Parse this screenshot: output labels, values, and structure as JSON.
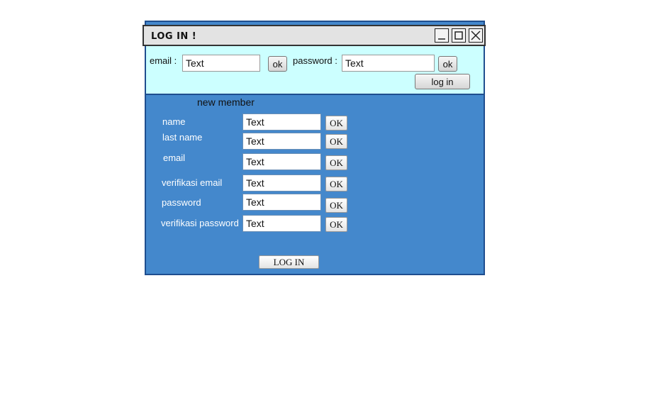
{
  "window": {
    "title": "LOG IN !",
    "controls": {
      "minimize": "minimize-icon",
      "maximize": "maximize-icon",
      "close": "close-icon"
    }
  },
  "login": {
    "email_label": "email :",
    "email_value": "Text",
    "email_ok": "ok",
    "password_label": "password :",
    "password_value": "Text",
    "password_ok": "ok",
    "login_button": "log in"
  },
  "new_member": {
    "heading": "new member",
    "fields": [
      {
        "label": "name",
        "value": "Text",
        "ok": "OK"
      },
      {
        "label": "last name",
        "value": "Text",
        "ok": "OK"
      },
      {
        "label": "email",
        "value": "Text",
        "ok": "OK"
      },
      {
        "label": "verifikasi email",
        "value": "Text",
        "ok": "OK"
      },
      {
        "label": "password",
        "value": "Text",
        "ok": "OK"
      },
      {
        "label": "verifikasi password",
        "value": "Text",
        "ok": "OK"
      }
    ],
    "submit": "LOG IN"
  },
  "colors": {
    "frame_blue": "#4488cc",
    "login_bar": "#ccffff",
    "border": "#1f4e8f"
  }
}
